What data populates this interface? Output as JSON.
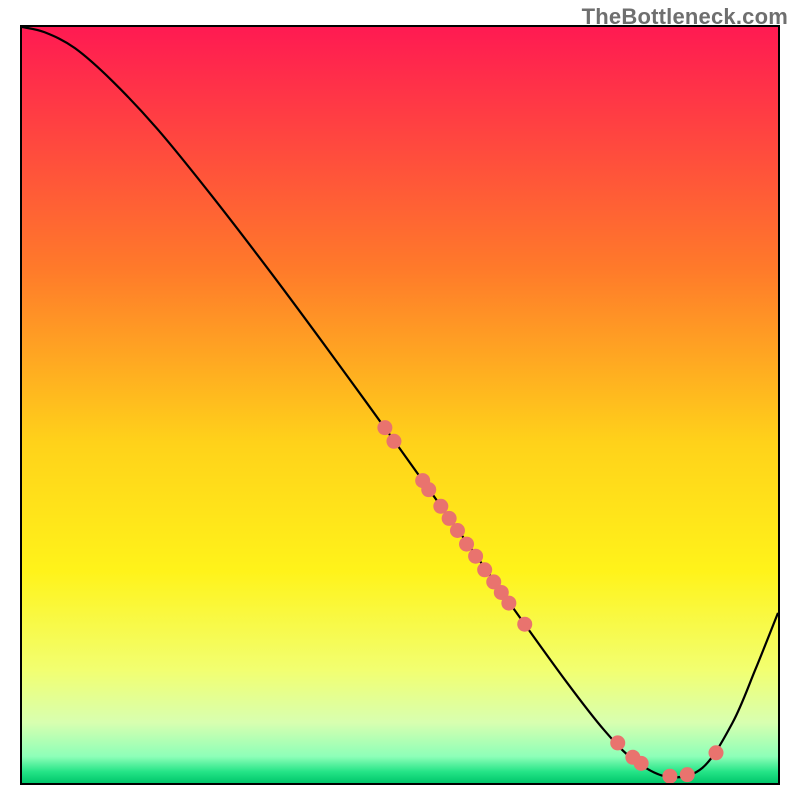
{
  "watermark": "TheBottleneck.com",
  "chart_data": {
    "type": "line",
    "title": "",
    "xlabel": "",
    "ylabel": "",
    "xlim": [
      0,
      100
    ],
    "ylim": [
      0,
      100
    ],
    "grid": false,
    "legend": false,
    "background_gradient": {
      "stops": [
        {
          "offset": 0.0,
          "color": "#ff1a52"
        },
        {
          "offset": 0.32,
          "color": "#ff7a2a"
        },
        {
          "offset": 0.55,
          "color": "#ffd21a"
        },
        {
          "offset": 0.72,
          "color": "#fff31a"
        },
        {
          "offset": 0.85,
          "color": "#f2ff70"
        },
        {
          "offset": 0.92,
          "color": "#d8ffb0"
        },
        {
          "offset": 0.965,
          "color": "#8dffb8"
        },
        {
          "offset": 0.985,
          "color": "#25e487"
        },
        {
          "offset": 1.0,
          "color": "#00c76b"
        }
      ]
    },
    "curve": {
      "x": [
        0,
        3,
        7,
        12,
        18,
        25,
        33,
        41,
        50,
        58,
        65,
        72,
        77,
        81,
        85.5,
        90,
        94,
        97,
        100
      ],
      "y": [
        100,
        99.3,
        97.2,
        92.8,
        86.4,
        77.8,
        67.4,
        56.6,
        44.2,
        33.0,
        23.1,
        13.4,
        7.0,
        3.0,
        0.8,
        2.0,
        8.0,
        15.0,
        22.5
      ]
    },
    "scatter": [
      {
        "x": 48.0,
        "y": 47.0
      },
      {
        "x": 49.2,
        "y": 45.2
      },
      {
        "x": 53.0,
        "y": 40.0
      },
      {
        "x": 53.8,
        "y": 38.8
      },
      {
        "x": 55.4,
        "y": 36.6
      },
      {
        "x": 56.5,
        "y": 35.0
      },
      {
        "x": 57.6,
        "y": 33.4
      },
      {
        "x": 58.8,
        "y": 31.6
      },
      {
        "x": 60.0,
        "y": 30.0
      },
      {
        "x": 61.2,
        "y": 28.2
      },
      {
        "x": 62.4,
        "y": 26.6
      },
      {
        "x": 63.4,
        "y": 25.2
      },
      {
        "x": 64.4,
        "y": 23.8
      },
      {
        "x": 66.5,
        "y": 21.0
      },
      {
        "x": 78.8,
        "y": 5.3
      },
      {
        "x": 80.8,
        "y": 3.4
      },
      {
        "x": 81.9,
        "y": 2.6
      },
      {
        "x": 85.7,
        "y": 0.9
      },
      {
        "x": 88.0,
        "y": 1.1
      },
      {
        "x": 91.8,
        "y": 4.0
      }
    ],
    "colors": {
      "curve": "#000000",
      "scatter": "#e9736e"
    }
  }
}
